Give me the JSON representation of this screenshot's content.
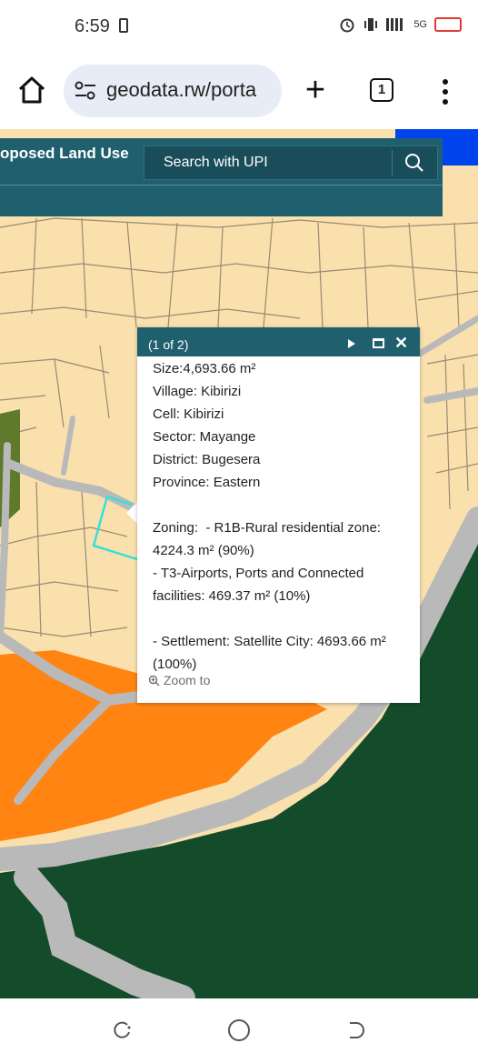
{
  "status_bar": {
    "time": "6:59",
    "network": "5G"
  },
  "browser": {
    "url": "geodata.rw/porta",
    "tab_count": "1",
    "new_tab_label": "+"
  },
  "app": {
    "title": "oposed Land Use",
    "search_placeholder": "Search with UPI"
  },
  "popup": {
    "title": "(1 of 2)",
    "lines": [
      "Size:4,693.66 m²",
      "Village: Kibirizi",
      "Cell: Kibirizi",
      "Sector: Mayange",
      "District: Bugesera",
      "Province: Eastern",
      "",
      "Zoning:  - R1B-Rural residential zone:",
      "4224.3 m² (90%)",
      "- T3-Airports, Ports and Connected",
      "facilities: 469.37 m² (10%)",
      "",
      "- Settlement: Satellite City: 4693.66 m²",
      "(100%)"
    ],
    "zoom_label": "Zoom to"
  },
  "map_colors": {
    "parcel": "#f9e0ad",
    "parcel_line": "#9a8a72",
    "road": "#b9b9b9",
    "forest": "#144c2b",
    "orange_zone": "#ff8412",
    "green_strip": "#5f7a2a",
    "selected": "#37e0d8",
    "header": "#1f5f6e"
  }
}
